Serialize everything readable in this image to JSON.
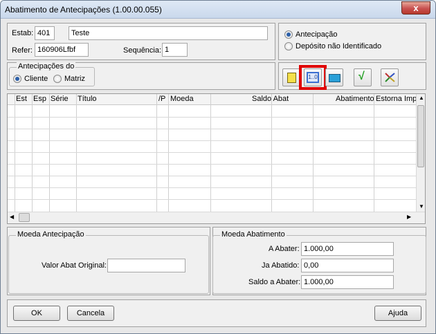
{
  "window": {
    "title": "Abatimento de Antecipações (1.00.00.055)",
    "close_glyph": "x"
  },
  "header": {
    "estab_label": "Estab:",
    "estab_value": "401",
    "estab_name": "Teste",
    "refer_label": "Refer:",
    "refer_value": "160906Lfbf",
    "sequencia_label": "Sequência:",
    "sequencia_value": "1"
  },
  "type_options": [
    {
      "label": "Antecipação",
      "selected": true
    },
    {
      "label": "Depósito não Identificado",
      "selected": false
    }
  ],
  "antecipacoes": {
    "group_label": "Antecipações do",
    "options": [
      {
        "label": "Cliente",
        "selected": true
      },
      {
        "label": "Matriz",
        "selected": false
      }
    ]
  },
  "toolbar": {
    "buttons": [
      {
        "name": "new-icon",
        "color": "#f5e04a"
      },
      {
        "name": "range-selection-icon",
        "color": "#3b6fd1",
        "highlighted": true
      },
      {
        "name": "folder-icon",
        "color": "#2aa0d8"
      },
      {
        "name": "checkmark-icon",
        "color": "#22a022"
      },
      {
        "name": "tree-icon",
        "color": "#c03030"
      }
    ],
    "range_glyph": "1..0",
    "check_glyph": "√"
  },
  "grid": {
    "columns": [
      "Est",
      "Esp",
      "Série",
      "Título",
      "/P",
      "Moeda",
      "Saldo Abat",
      "Abatimento",
      "Estorna Impl"
    ]
  },
  "moeda_antecipacao": {
    "group_label": "Moeda Antecipação",
    "valor_label": "Valor Abat Original:",
    "valor_value": ""
  },
  "moeda_abatimento": {
    "group_label": "Moeda Abatimento",
    "a_abater_label": "A Abater:",
    "a_abater_value": "1.000,00",
    "ja_abatido_label": "Ja Abatido:",
    "ja_abatido_value": "0,00",
    "saldo_label": "Saldo a Abater:",
    "saldo_value": "1.000,00"
  },
  "footer": {
    "ok_label": "OK",
    "cancel_label": "Cancela",
    "help_label": "Ajuda"
  }
}
